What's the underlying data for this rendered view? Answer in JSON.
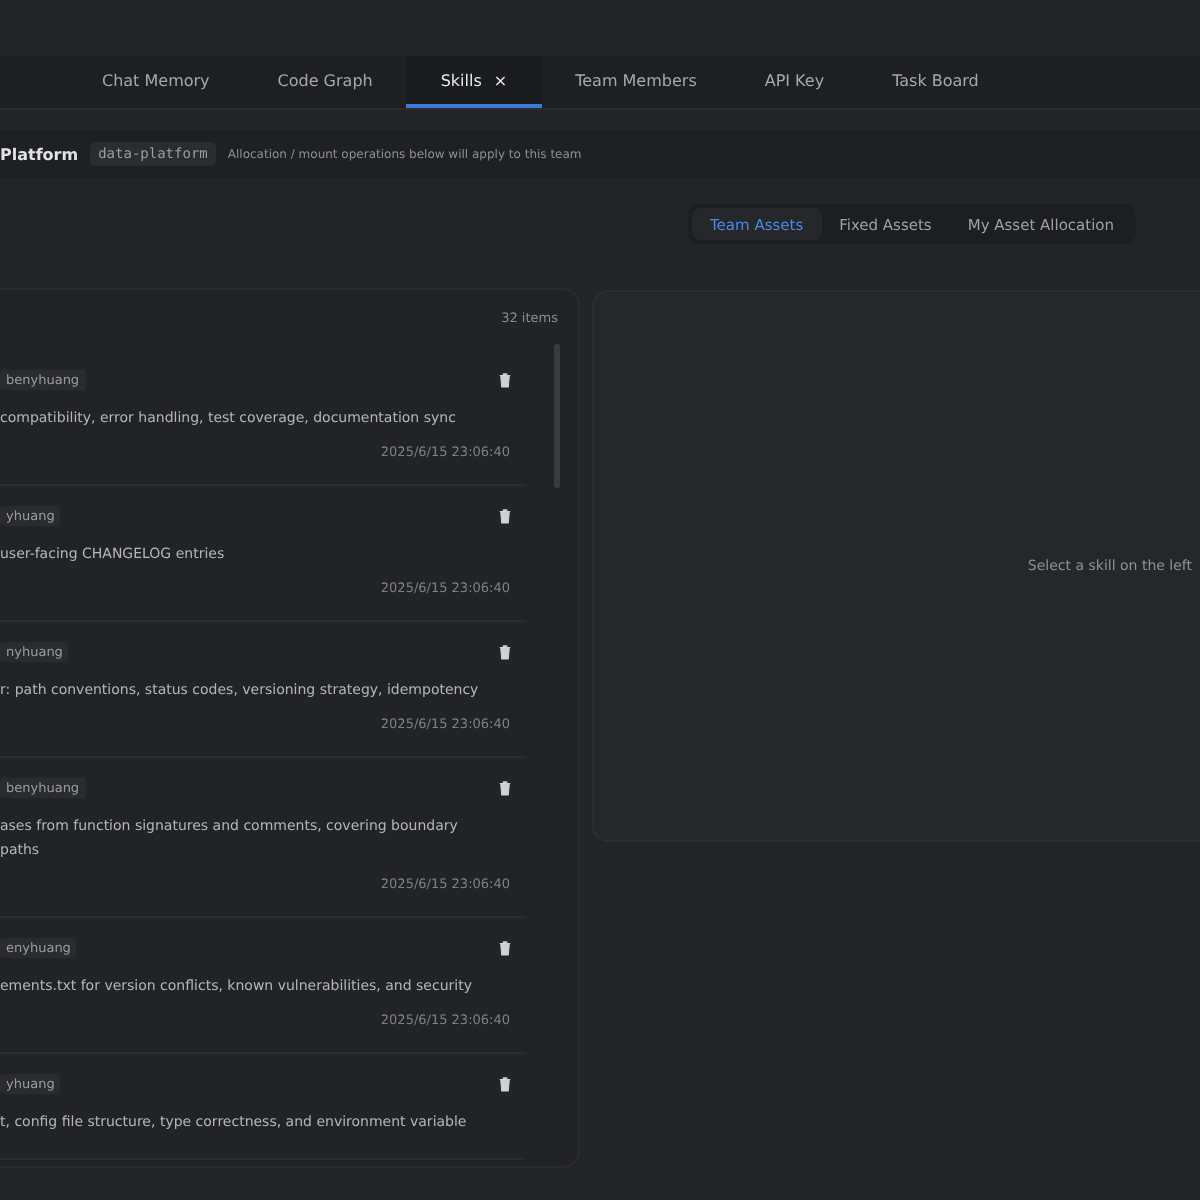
{
  "tabs": [
    {
      "label": "Chat Memory",
      "selected": false
    },
    {
      "label": "Code Graph",
      "selected": false
    },
    {
      "label": "Skills",
      "selected": true,
      "close_icon": "×"
    },
    {
      "label": "Team Members",
      "selected": false
    },
    {
      "label": "API Key",
      "selected": false
    },
    {
      "label": "Task Board",
      "selected": false
    }
  ],
  "team_bar": {
    "name": "Platform",
    "code": "data-platform",
    "hint": "Allocation / mount operations below will apply to this team"
  },
  "asset_tabs": [
    {
      "label": "Team Assets",
      "selected": true
    },
    {
      "label": "Fixed Assets",
      "selected": false
    },
    {
      "label": "My Asset Allocation",
      "selected": false
    }
  ],
  "skill_list": {
    "count": "32 items",
    "items": [
      {
        "author": "benyhuang",
        "description": "compatibility, error handling, test coverage, documentation sync",
        "time": "2025/6/15 23:06:40"
      },
      {
        "author": "yhuang",
        "description": "user-facing CHANGELOG entries",
        "time": "2025/6/15 23:06:40"
      },
      {
        "author": "nyhuang",
        "description": "r: path conventions, status codes, versioning strategy, idempotency",
        "time": "2025/6/15 23:06:40"
      },
      {
        "author": "benyhuang",
        "description": "ases from function signatures and comments, covering boundary paths",
        "time": "2025/6/15 23:06:40"
      },
      {
        "author": "enyhuang",
        "description": "ements.txt for version conflicts, known vulnerabilities, and security",
        "time": "2025/6/15 23:06:40"
      },
      {
        "author": "yhuang",
        "description": "t, config file structure, type correctness, and environment variable"
      }
    ]
  },
  "detail": {
    "empty_text": "Select a skill on the left"
  }
}
